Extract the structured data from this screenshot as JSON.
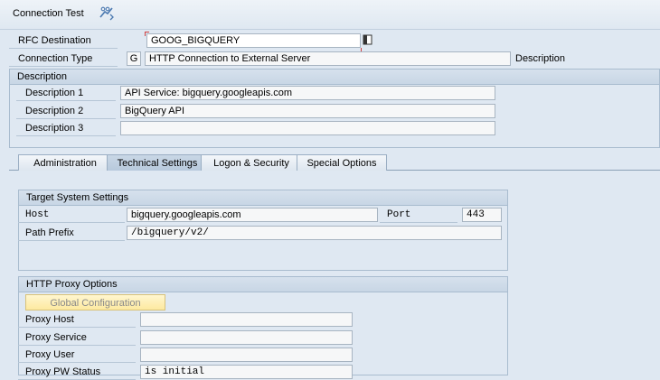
{
  "toolbar": {
    "title": "Connection Test",
    "icon": "test-connection-icon"
  },
  "header": {
    "rfc_destination": {
      "label": "RFC Destination",
      "value": "GOOG_BIGQUERY"
    },
    "connection_type": {
      "label": "Connection Type",
      "code": "G",
      "value": "HTTP Connection to External Server",
      "trailing_label": "Description"
    }
  },
  "description": {
    "title": "Description",
    "rows": [
      {
        "label": "Description 1",
        "value": "API Service: bigquery.googleapis.com"
      },
      {
        "label": "Description 2",
        "value": "BigQuery API"
      },
      {
        "label": "Description 3",
        "value": ""
      }
    ]
  },
  "tabs": [
    {
      "label": "Administration",
      "active": false
    },
    {
      "label": "Technical Settings",
      "active": true
    },
    {
      "label": "Logon & Security",
      "active": false
    },
    {
      "label": "Special Options",
      "active": false
    }
  ],
  "target_system": {
    "title": "Target System Settings",
    "host": {
      "label": "Host",
      "value": "bigquery.googleapis.com"
    },
    "port": {
      "label": "Port",
      "value": "443"
    },
    "path_prefix": {
      "label": "Path Prefix",
      "value": "/bigquery/v2/"
    }
  },
  "proxy": {
    "title": "HTTP Proxy Options",
    "global_config_label": "Global Configuration",
    "fields": [
      {
        "label": "Proxy Host",
        "value": ""
      },
      {
        "label": "Proxy Service",
        "value": ""
      },
      {
        "label": "Proxy User",
        "value": ""
      },
      {
        "label": "Proxy PW Status",
        "value": "is initial"
      }
    ]
  },
  "colors": {
    "background": "#dfe8f2",
    "field_border": "#a7b4c1",
    "button_yellow": "#fde9a0",
    "required_marker": "#d04040"
  }
}
